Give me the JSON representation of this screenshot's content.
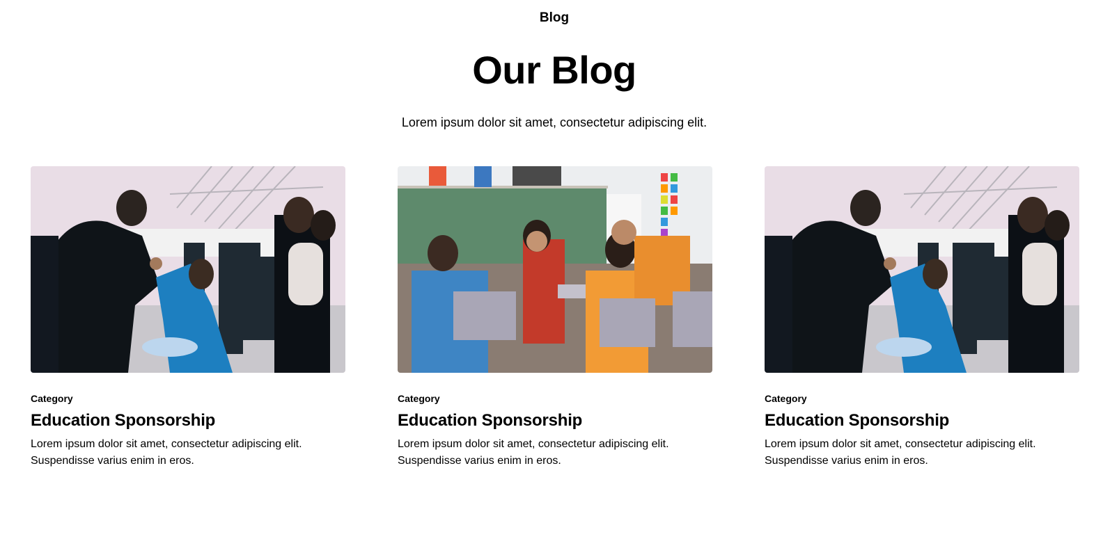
{
  "header": {
    "tagline": "Blog",
    "title": "Our Blog",
    "subtitle": "Lorem ipsum dolor sit amet, consectetur adipiscing elit."
  },
  "posts": [
    {
      "image": "photo-volunteer-fist-bump",
      "category": "Category",
      "title": "Education Sponsorship",
      "excerpt_line1": "Lorem ipsum dolor sit amet, consectetur adipiscing elit.",
      "excerpt_line2": "Suspendisse varius enim in eros."
    },
    {
      "image": "photo-classroom-children",
      "category": "Category",
      "title": "Education Sponsorship",
      "excerpt_line1": "Lorem ipsum dolor sit amet, consectetur adipiscing elit.",
      "excerpt_line2": "Suspendisse varius enim in eros."
    },
    {
      "image": "photo-volunteer-fist-bump",
      "category": "Category",
      "title": "Education Sponsorship",
      "excerpt_line1": "Lorem ipsum dolor sit amet, consectetur adipiscing elit.",
      "excerpt_line2": "Suspendisse varius enim in eros."
    }
  ]
}
